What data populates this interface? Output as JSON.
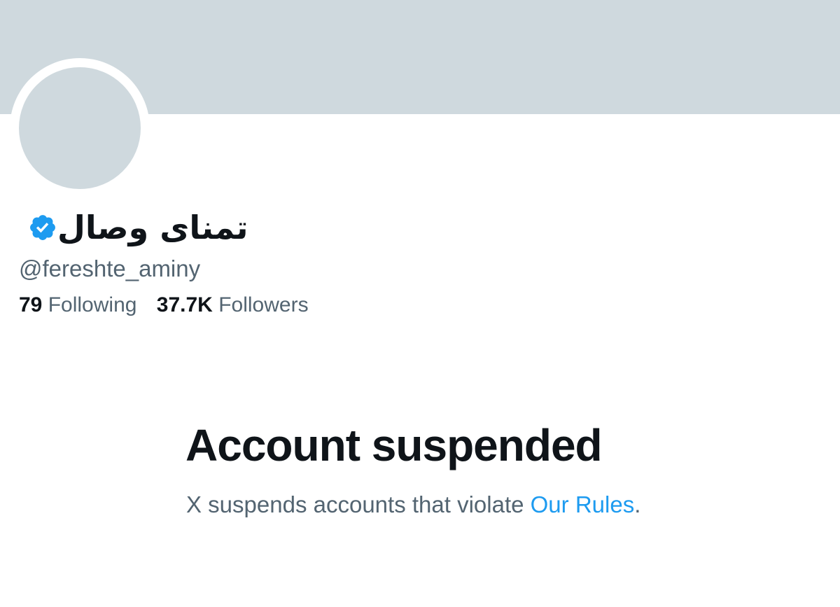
{
  "colors": {
    "banner": "#cfd9de",
    "avatar_placeholder": "#cfd9de",
    "primary_text": "#0f1419",
    "secondary_text": "#536471",
    "link": "#1d9bf0",
    "verified_badge": "#1d9bf0"
  },
  "profile": {
    "display_name": "تمنای وصال",
    "verified_icon": "verified-badge-icon",
    "handle": "@fereshte_aminy",
    "following_count": "79",
    "following_label": "Following",
    "followers_count": "37.7K",
    "followers_label": "Followers"
  },
  "suspension": {
    "title": "Account suspended",
    "message_prefix": "X suspends accounts that violate ",
    "rules_link": "Our Rules",
    "message_suffix": "."
  }
}
